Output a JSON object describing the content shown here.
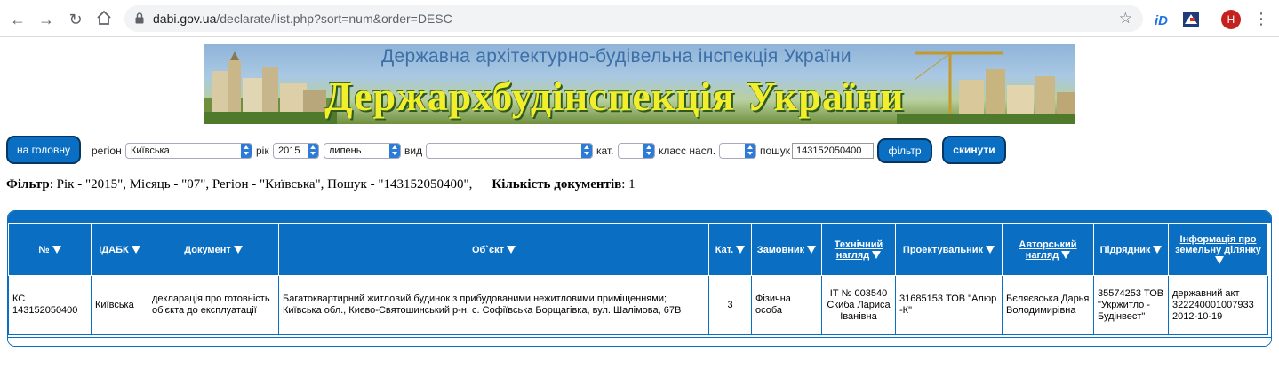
{
  "browser": {
    "url_host": "dabi.gov.ua",
    "url_path": "/declarate/list.php?sort=num&order=DESC",
    "avatar_letter": "H",
    "icons": [
      "back-icon",
      "forward-icon",
      "reload-icon",
      "home-icon",
      "lock-icon",
      "star-icon",
      "extension-id-icon",
      "extension-flag-icon",
      "menu-icon"
    ]
  },
  "banner": {
    "subtitle": "Державна архітектурно-будівельна інспекція України",
    "title": "Держархбудінспекція України"
  },
  "filter": {
    "home_label": "на головну",
    "region_label": "регіон",
    "region_value": "Київська",
    "year_label": "рік",
    "year_value": "2015",
    "month_value": "липень",
    "type_label": "вид",
    "type_value": "",
    "cat_label": "кат.",
    "cat_value": "",
    "class_label": "класс насл.",
    "class_value": "",
    "search_label": "пошук",
    "search_value": "143152050400",
    "filter_button": "фільтр",
    "reset_button": "скинути"
  },
  "summary": {
    "filter_label": "Фільтр",
    "filter_text": ": Рік - \"2015\", Місяць - \"07\", Регіон - \"Київська\", Пошук - \"143152050400\",",
    "count_label": "Кількість документів",
    "count_text": ": 1"
  },
  "table": {
    "headers": {
      "num": "№",
      "idabk": "ІДАБК",
      "doc": "Документ",
      "object": "Об`єкт",
      "cat": "Кат.",
      "customer": "Замовник",
      "tech_line1": "Технічний",
      "tech_line2": "нагляд",
      "designer": "Проектувальник",
      "author_line1": "Авторський",
      "author_line2": "нагляд",
      "contractor": "Підрядник",
      "land_line1": "Інформація про",
      "land_line2": "земельну ділянку"
    },
    "row": {
      "num": "КС 143152050400",
      "idabk": "Київська",
      "doc": "декларація про готовність об'єкта до експлуатації",
      "object": "Багатоквартирний житловий будинок з прибудованими нежитловими приміщеннями; Київська обл., Києво-Святошинський р-н, с. Софіївська Борщагівка, вул. Шалімова, 67В",
      "cat": "3",
      "customer": "Фізична особа",
      "tech": "ІТ № 003540 Скиба Лариса Іванівна",
      "designer": "31685153 ТОВ \"Алюр -К\"",
      "author": "Бєляєвська Дарья Володимирівна",
      "contractor": "35574253 ТОВ \"Укржитло - Будінвест\"",
      "land": "державний акт 322240001007933 2012-10-19"
    }
  }
}
